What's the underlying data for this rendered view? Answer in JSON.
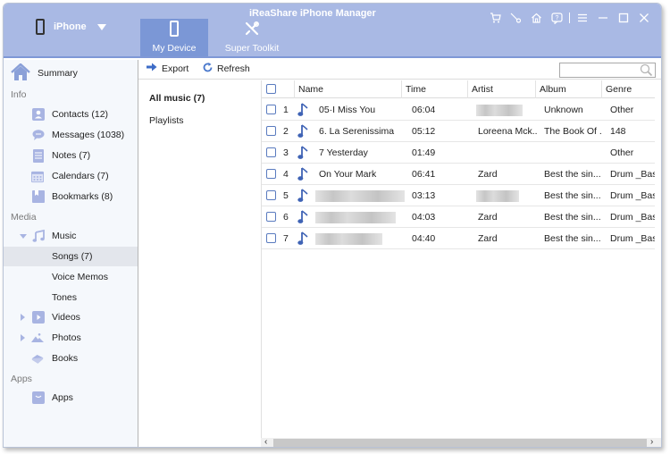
{
  "app": {
    "title": "iReaShare iPhone Manager",
    "device_name": "iPhone"
  },
  "nav_tabs": [
    {
      "label": "My Device",
      "icon": "phone-icon",
      "active": true
    },
    {
      "label": "Super Toolkit",
      "icon": "tools-icon",
      "active": false
    }
  ],
  "title_controls": [
    "cart-icon",
    "key-icon",
    "home-icon",
    "feedback-icon",
    "menu-icon",
    "minimize-icon",
    "maximize-icon",
    "close-icon"
  ],
  "sidebar": {
    "summary": "Summary",
    "sections": {
      "info": "Info",
      "media": "Media",
      "apps": "Apps"
    },
    "info_items": [
      {
        "label": "Contacts  (12)",
        "icon": "contacts-icon"
      },
      {
        "label": "Messages  (1038)",
        "icon": "messages-icon"
      },
      {
        "label": "Notes  (7)",
        "icon": "notes-icon"
      },
      {
        "label": "Calendars  (7)",
        "icon": "calendar-icon"
      },
      {
        "label": "Bookmarks  (8)",
        "icon": "bookmark-icon"
      }
    ],
    "media_items": {
      "music": "Music",
      "songs": "Songs  (7)",
      "voice_memos": "Voice Memos",
      "tones": "Tones",
      "videos": "Videos",
      "photos": "Photos",
      "books": "Books"
    },
    "apps_item": "Apps"
  },
  "toolbar": {
    "export_label": "Export",
    "refresh_label": "Refresh",
    "search_placeholder": ""
  },
  "subnav": {
    "all_music": "All music (7)",
    "playlists": "Playlists"
  },
  "table": {
    "columns": [
      "Name",
      "Time",
      "Artist",
      "Album",
      "Genre"
    ],
    "rows": [
      {
        "index": "1",
        "name": "05·I Miss You",
        "time": "06:04",
        "artist": "",
        "artist_blurred": true,
        "album": "Unknown",
        "genre": "Other",
        "name_blurred": false
      },
      {
        "index": "2",
        "name": "6. La Serenissima",
        "time": "05:12",
        "artist": "Loreena Mck...",
        "artist_blurred": false,
        "album": "The Book Of ...",
        "genre": "148",
        "name_blurred": false
      },
      {
        "index": "3",
        "name": "7  Yesterday",
        "time": "01:49",
        "artist": "",
        "artist_blurred": false,
        "album": "",
        "genre": "Other",
        "name_blurred": false
      },
      {
        "index": "4",
        "name": "On Your Mark",
        "time": "06:41",
        "artist": "Zard",
        "artist_blurred": false,
        "album": "Best the sin...",
        "genre": "Drum _Bass",
        "name_blurred": false
      },
      {
        "index": "5",
        "name": "",
        "time": "03:13",
        "artist": "",
        "artist_blurred": true,
        "album": "Best the sin...",
        "genre": "Drum _Bass",
        "name_blurred": true
      },
      {
        "index": "6",
        "name": "",
        "time": "04:03",
        "artist": "Zard",
        "artist_blurred": false,
        "album": "Best the sin...",
        "genre": "Drum _Bass",
        "name_blurred": true
      },
      {
        "index": "7",
        "name": "",
        "time": "04:40",
        "artist": "Zard",
        "artist_blurred": false,
        "album": "Best the sin...",
        "genre": "Drum _Bass",
        "name_blurred": true
      }
    ]
  },
  "colors": {
    "header_bg": "#a9b9e4",
    "active_tab_bg": "#7b97d6",
    "icon_accent": "#a8b4e2",
    "note_blue": "#3f63b5"
  }
}
